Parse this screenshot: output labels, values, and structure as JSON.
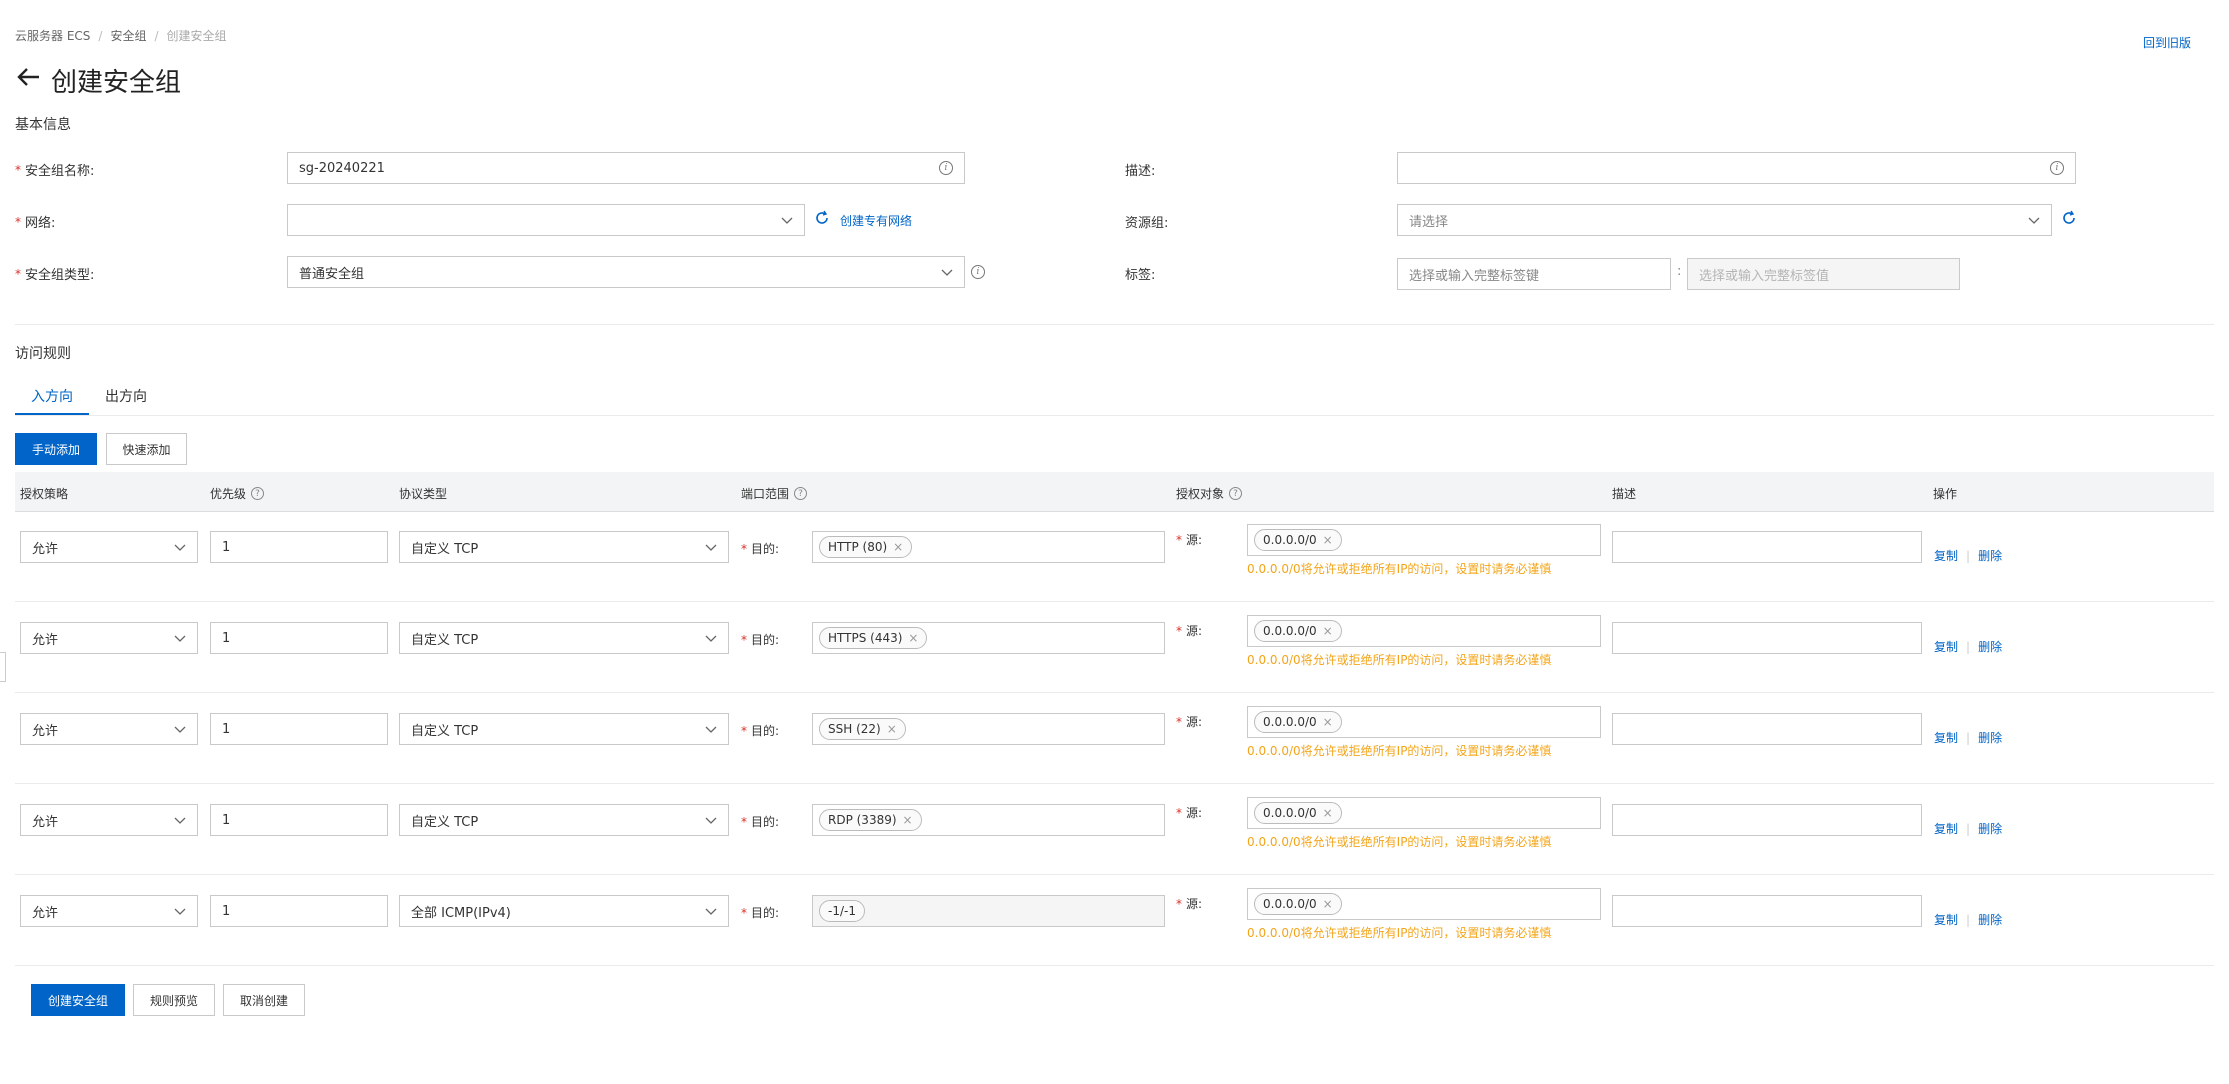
{
  "breadcrumb": {
    "item1": "云服务器 ECS",
    "sep": "/",
    "item2": "安全组",
    "current": "创建安全组"
  },
  "header": {
    "title": "创建安全组",
    "back_link": "回到旧版"
  },
  "basic": {
    "section_title": "基本信息",
    "name_label": "安全组名称:",
    "name_value": "sg-20240221",
    "network_label": "网络:",
    "create_vpc_link": "创建专有网络",
    "type_label": "安全组类型:",
    "type_value": "普通安全组",
    "desc_label": "描述:",
    "rg_label": "资源组:",
    "rg_placeholder": "请选择",
    "tag_label": "标签:",
    "tag_key_placeholder": "选择或输入完整标签键",
    "tag_sep": ":",
    "tag_value_placeholder": "选择或输入完整标签值"
  },
  "rules": {
    "section_title": "访问规则",
    "tabs": [
      "入方向",
      "出方向"
    ],
    "add_manual": "手动添加",
    "add_quick": "快速添加",
    "columns": [
      "授权策略",
      "优先级",
      "协议类型",
      "端口范围",
      "授权对象",
      "描述",
      "操作"
    ],
    "dest_label": "目的:",
    "src_label": "源:",
    "warning": "0.0.0.0/0将允许或拒绝所有IP的访问，设置时请务必谨慎",
    "copy": "复制",
    "delete": "删除",
    "rows": [
      {
        "policy": "允许",
        "priority": "1",
        "protocol": "自定义 TCP",
        "port": "HTTP (80)",
        "source": "0.0.0.0/0"
      },
      {
        "policy": "允许",
        "priority": "1",
        "protocol": "自定义 TCP",
        "port": "HTTPS (443)",
        "source": "0.0.0.0/0"
      },
      {
        "policy": "允许",
        "priority": "1",
        "protocol": "自定义 TCP",
        "port": "SSH (22)",
        "source": "0.0.0.0/0"
      },
      {
        "policy": "允许",
        "priority": "1",
        "protocol": "自定义 TCP",
        "port": "RDP (3389)",
        "source": "0.0.0.0/0"
      },
      {
        "policy": "允许",
        "priority": "1",
        "protocol": "全部 ICMP(IPv4)",
        "port": "-1/-1",
        "source": "0.0.0.0/0"
      }
    ]
  },
  "footer": {
    "create": "创建安全组",
    "preview": "规则预览",
    "cancel": "取消创建"
  },
  "colors": {
    "primary": "#0064c8",
    "required": "#d93026",
    "warning": "#f3a51a"
  }
}
